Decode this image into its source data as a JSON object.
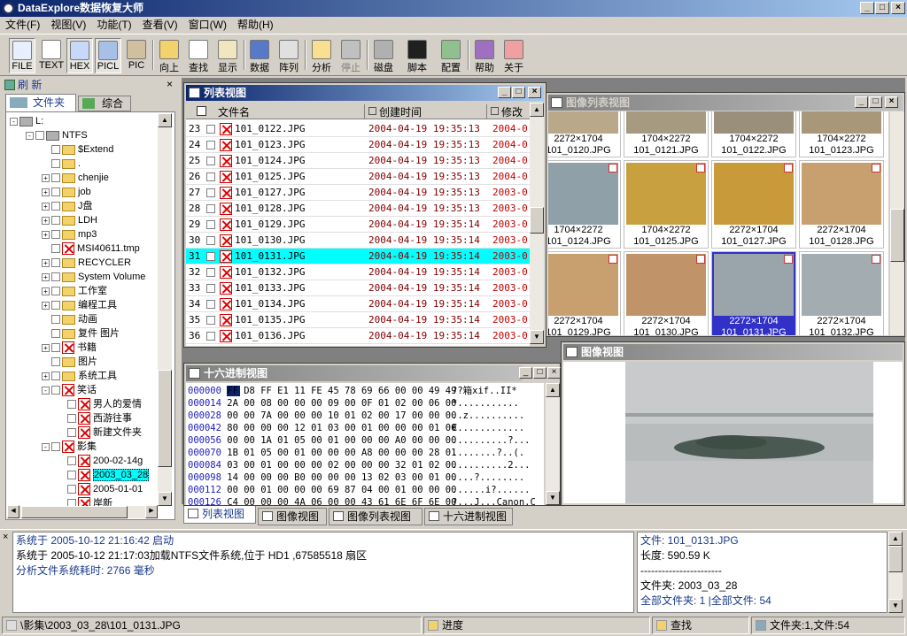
{
  "window": {
    "title": "DataExplore数据恢复大师"
  },
  "menu": [
    "文件(F)",
    "视图(V)",
    "功能(T)",
    "查看(V)",
    "窗口(W)",
    "帮助(H)"
  ],
  "toolbar": {
    "file": "FILE",
    "text": "TEXT",
    "hex": "HEX",
    "picl": "PICL",
    "pic": "PIC",
    "up": "向上",
    "find": "查找",
    "show": "显示",
    "data": "数据",
    "array": "阵列",
    "analyze": "分析",
    "stop": "停止",
    "disk": "磁盘",
    "script": "脚本",
    "config": "配置",
    "help": "帮助",
    "about": "关于"
  },
  "left": {
    "refresh": "刷 新",
    "tab_folder": "文件夹",
    "tab_all": "综合",
    "tree": [
      {
        "label": "L:",
        "indent": 14,
        "kind": "drive",
        "exp": "-"
      },
      {
        "label": "NTFS",
        "indent": 32,
        "kind": "disk",
        "exp": "-"
      },
      {
        "label": "$Extend",
        "indent": 50,
        "kind": "folder",
        "exp": ""
      },
      {
        "label": ".",
        "indent": 50,
        "kind": "folder",
        "exp": ""
      },
      {
        "label": "chenjie",
        "indent": 50,
        "kind": "folder",
        "exp": "+"
      },
      {
        "label": "job",
        "indent": 50,
        "kind": "folder",
        "exp": "+"
      },
      {
        "label": "J盘",
        "indent": 50,
        "kind": "folder",
        "exp": "+"
      },
      {
        "label": "LDH",
        "indent": 50,
        "kind": "folder",
        "exp": "+"
      },
      {
        "label": "mp3",
        "indent": 50,
        "kind": "folder",
        "exp": "+"
      },
      {
        "label": "MSI40611.tmp",
        "indent": 50,
        "kind": "x",
        "exp": ""
      },
      {
        "label": "RECYCLER",
        "indent": 50,
        "kind": "folder",
        "exp": "+"
      },
      {
        "label": "System Volume",
        "indent": 50,
        "kind": "folder",
        "exp": "+"
      },
      {
        "label": "工作室",
        "indent": 50,
        "kind": "folder",
        "exp": "+"
      },
      {
        "label": "编程工具",
        "indent": 50,
        "kind": "folder",
        "exp": "+"
      },
      {
        "label": "动画",
        "indent": 50,
        "kind": "folder",
        "exp": ""
      },
      {
        "label": "复件 图片",
        "indent": 50,
        "kind": "folder",
        "exp": ""
      },
      {
        "label": "书籍",
        "indent": 50,
        "kind": "x",
        "exp": "+"
      },
      {
        "label": "图片",
        "indent": 50,
        "kind": "folder",
        "exp": ""
      },
      {
        "label": "系统工具",
        "indent": 50,
        "kind": "folder",
        "exp": "+"
      },
      {
        "label": "笑话",
        "indent": 50,
        "kind": "x",
        "exp": "-"
      },
      {
        "label": "男人的爱情",
        "indent": 68,
        "kind": "x",
        "exp": ""
      },
      {
        "label": "西游往事",
        "indent": 68,
        "kind": "x",
        "exp": ""
      },
      {
        "label": "新建文件夹",
        "indent": 68,
        "kind": "x",
        "exp": ""
      },
      {
        "label": "影集",
        "indent": 50,
        "kind": "x",
        "exp": "-"
      },
      {
        "label": "200-02-14g",
        "indent": 68,
        "kind": "x",
        "exp": ""
      },
      {
        "label": "2003_03_28",
        "indent": 68,
        "kind": "x",
        "exp": "",
        "sel": true
      },
      {
        "label": "2005-01-01",
        "indent": 68,
        "kind": "x",
        "exp": ""
      },
      {
        "label": "岸新",
        "indent": 68,
        "kind": "x",
        "exp": ""
      }
    ]
  },
  "list": {
    "title": "列表视图",
    "col_name": "文件名",
    "col_created": "创建时间",
    "col_modified": "修改",
    "rows": [
      {
        "n": "23",
        "f": "101_0122.JPG",
        "c": "2004-04-19  19:35:13",
        "m": "2004-0"
      },
      {
        "n": "24",
        "f": "101_0123.JPG",
        "c": "2004-04-19  19:35:13",
        "m": "2004-0"
      },
      {
        "n": "25",
        "f": "101_0124.JPG",
        "c": "2004-04-19  19:35:13",
        "m": "2004-0"
      },
      {
        "n": "26",
        "f": "101_0125.JPG",
        "c": "2004-04-19  19:35:13",
        "m": "2004-0"
      },
      {
        "n": "27",
        "f": "101_0127.JPG",
        "c": "2004-04-19  19:35:13",
        "m": "2003-0"
      },
      {
        "n": "28",
        "f": "101_0128.JPG",
        "c": "2004-04-19  19:35:13",
        "m": "2003-0"
      },
      {
        "n": "29",
        "f": "101_0129.JPG",
        "c": "2004-04-19  19:35:14",
        "m": "2003-0"
      },
      {
        "n": "30",
        "f": "101_0130.JPG",
        "c": "2004-04-19  19:35:14",
        "m": "2003-0"
      },
      {
        "n": "31",
        "f": "101_0131.JPG",
        "c": "2004-04-19  19:35:14",
        "m": "2003-0",
        "sel": true
      },
      {
        "n": "32",
        "f": "101_0132.JPG",
        "c": "2004-04-19  19:35:14",
        "m": "2003-0"
      },
      {
        "n": "33",
        "f": "101_0133.JPG",
        "c": "2004-04-19  19:35:14",
        "m": "2003-0"
      },
      {
        "n": "34",
        "f": "101_0134.JPG",
        "c": "2004-04-19  19:35:14",
        "m": "2003-0"
      },
      {
        "n": "35",
        "f": "101_0135.JPG",
        "c": "2004-04-19  19:35:14",
        "m": "2003-0"
      },
      {
        "n": "36",
        "f": "101_0136.JPG",
        "c": "2004-04-19  19:35:14",
        "m": "2003-0"
      }
    ]
  },
  "thumbs": {
    "title": "图像列表视图",
    "items": [
      {
        "d": "2272×1704",
        "f": "101_0120.JPG",
        "c": "#b9a88a"
      },
      {
        "d": "1704×2272",
        "f": "101_0121.JPG",
        "c": "#a69a80"
      },
      {
        "d": "1704×2272",
        "f": "101_0122.JPG",
        "c": "#9a8f7a"
      },
      {
        "d": "1704×2272",
        "f": "101_0123.JPG",
        "c": "#a9977a"
      },
      {
        "d": "1704×2272",
        "f": "101_0124.JPG",
        "c": "#8fa0a8"
      },
      {
        "d": "1704×2272",
        "f": "101_0125.JPG",
        "c": "#c8a040"
      },
      {
        "d": "2272×1704",
        "f": "101_0127.JPG",
        "c": "#c89a3a"
      },
      {
        "d": "2272×1704",
        "f": "101_0128.JPG",
        "c": "#c8a070"
      },
      {
        "d": "2272×1704",
        "f": "101_0129.JPG",
        "c": "#c8a070"
      },
      {
        "d": "2272×1704",
        "f": "101_0130.JPG",
        "c": "#c09468"
      },
      {
        "d": "2272×1704",
        "f": "101_0131.JPG",
        "c": "#9aa4ab",
        "sel": true
      },
      {
        "d": "2272×1704",
        "f": "101_0132.JPG",
        "c": "#a3acb1"
      }
    ]
  },
  "hex": {
    "title": "十六进制视图",
    "rows": [
      {
        "o": "000000",
        "b": "FF D8 FF E1 11 FE 45 78 69 66 00 00 49 49",
        "a": "  ??箱xif..II*"
      },
      {
        "o": "000014",
        "b": "2A 00 08 00 00 00 09 00 0F 01 02 00 06 00",
        "a": "*..........."
      },
      {
        "o": "000028",
        "b": "00 00 7A 00 00 00 10 01 02 00 17 00 00 00",
        "a": "..z.........."
      },
      {
        "o": "000042",
        "b": "80 00 00 00 12 01 03 00 01 00 00 00 01 00",
        "a": "€............"
      },
      {
        "o": "000056",
        "b": "00 00 1A 01 05 00 01 00 00 00 A0 00 00 00",
        "a": "..........?..."
      },
      {
        "o": "000070",
        "b": "1B 01 05 00 01 00 00 00 A8 00 00 00 28 01",
        "a": "........?..(."
      },
      {
        "o": "000084",
        "b": "03 00 01 00 00 00 02 00 00 00 32 01 02 00",
        "a": "..........2..."
      },
      {
        "o": "000098",
        "b": "14 00 00 00 B0 00 00 00 13 02 03 00 01 00",
        "a": "....?........"
      },
      {
        "o": "000112",
        "b": "00 00 01 00 00 00 69 87 04 00 01 00 00 00",
        "a": "......i?......"
      },
      {
        "o": "000126",
        "b": "C4 00 00 00 4A 06 00 00 43 61 6E 6F 6E 00",
        "a": "?...J...Canon.C"
      }
    ]
  },
  "image": {
    "title": "图像视图"
  },
  "tabs": [
    "列表视图",
    "图像视图",
    "图像列表视图",
    "十六进制视图"
  ],
  "log": [
    "系统于 2005-10-12 21:16:42 启动",
    "系统于 2005-10-12 21:17:03加载NTFS文件系统,位于 HD1 ,67585518 扇区",
    "分析文件系统耗时: 2766 毫秒"
  ],
  "info": [
    "文件: 101_0131.JPG",
    "长度: 590.59 K",
    "-----------------------",
    "文件夹: 2003_03_28",
    "全部文件夹: 1  |全部文件: 54"
  ],
  "status": {
    "path": "\\影集\\2003_03_28\\101_0131.JPG",
    "progress": "进度",
    "search": "查找",
    "counts": "文件夹:1,文件:54"
  }
}
